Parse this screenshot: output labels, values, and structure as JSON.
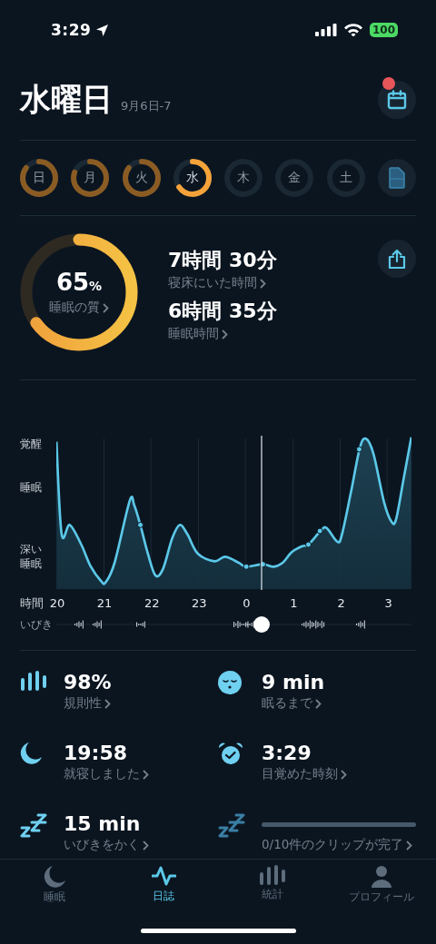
{
  "status_bar": {
    "time": "3:29",
    "battery": "100"
  },
  "header": {
    "title": "水曜日",
    "subtitle": "9月6日-7",
    "calendar_badge": true
  },
  "week": [
    {
      "kind": "day",
      "label": "日",
      "level": 0.85,
      "selected": false
    },
    {
      "kind": "day",
      "label": "月",
      "level": 0.8,
      "selected": false
    },
    {
      "kind": "day",
      "label": "火",
      "level": 0.85,
      "selected": false
    },
    {
      "kind": "day",
      "label": "水",
      "level": 0.65,
      "selected": true
    },
    {
      "kind": "day",
      "label": "木",
      "selected": false
    },
    {
      "kind": "day",
      "label": "金",
      "selected": false
    },
    {
      "kind": "day",
      "label": "土",
      "selected": false
    },
    {
      "kind": "report"
    }
  ],
  "summary": {
    "quality": {
      "value": "65",
      "unit": "%",
      "label": "睡眠の質",
      "level": 0.65
    },
    "stats": [
      {
        "value": "7時間 30分",
        "label": "寝床にいた時間"
      },
      {
        "value": "6時間 35分",
        "label": "睡眠時間"
      }
    ]
  },
  "chart": {
    "y_labels": [
      "覚醒",
      "睡眠",
      "深い睡眠"
    ],
    "x_title": "時間",
    "x_labels": [
      "20",
      "21",
      "22",
      "23",
      "0",
      "1",
      "2",
      "3"
    ],
    "snore_label": "いびき"
  },
  "metrics": [
    {
      "kind": "value",
      "value": "98%",
      "label": "規則性"
    },
    {
      "kind": "value",
      "value": "9 min",
      "label": "眠るまで"
    },
    {
      "kind": "value",
      "value": "19:58",
      "label": "就寝しました"
    },
    {
      "kind": "value",
      "value": "3:29",
      "label": "目覚めた時刻"
    },
    {
      "kind": "value",
      "value": "15 min",
      "label": "いびきをかく"
    },
    {
      "kind": "progress",
      "label": "0/10件のクリップが完了"
    }
  ],
  "tabs": [
    {
      "label": "睡眠",
      "selected": false
    },
    {
      "label": "日誌",
      "selected": true
    },
    {
      "label": "統計",
      "selected": false
    },
    {
      "label": "プロフィール",
      "selected": false
    }
  ]
}
